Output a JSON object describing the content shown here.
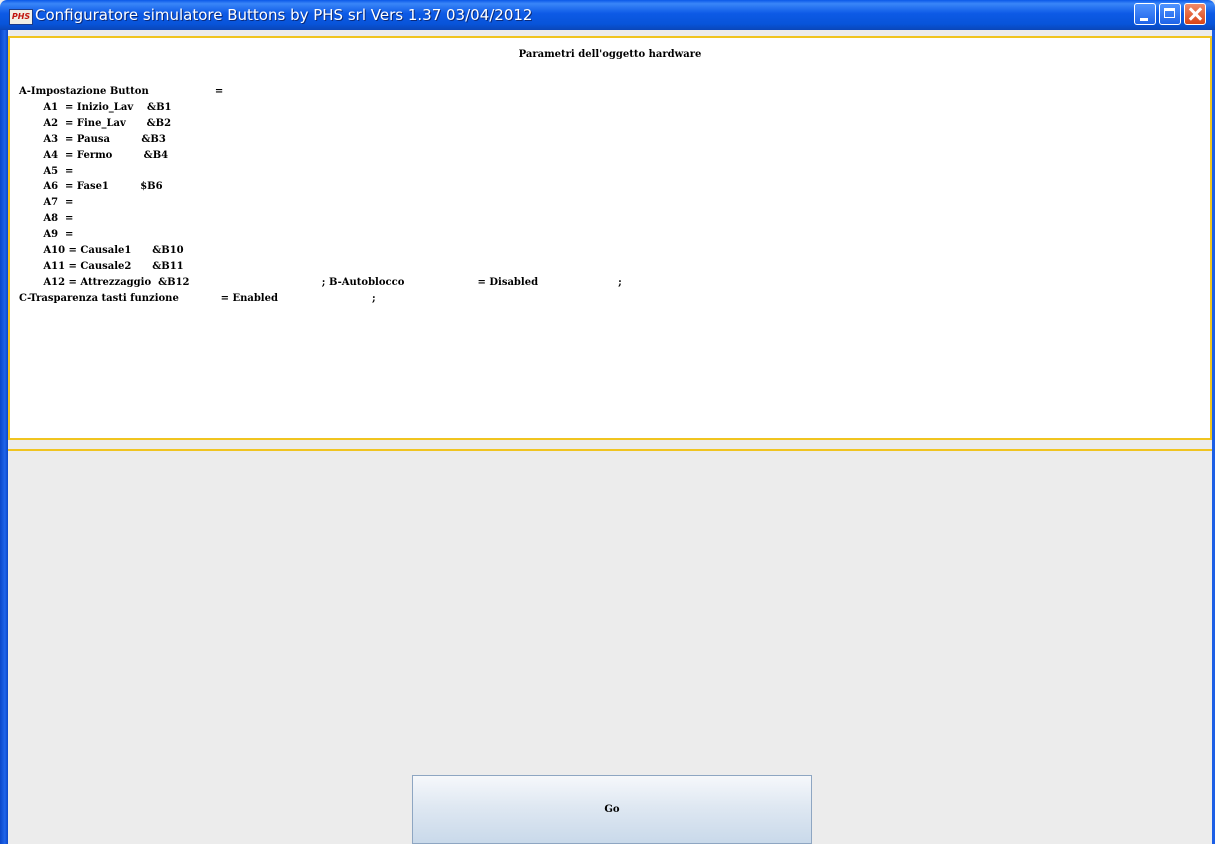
{
  "window": {
    "icon_label": "PHS",
    "title": "Configuratore simulatore Buttons by PHS srl  Vers 1.37  03/04/2012"
  },
  "parameters": {
    "heading": "Parametri dell'oggetto hardware",
    "content": "A-Impostazione Button                   =\n       A1  = Inizio_Lav    &B1\n       A2  = Fine_Lav      &B2\n       A3  = Pausa         &B3\n       A4  = Fermo         &B4\n       A5  =\n       A6  = Fase1         $B6\n       A7  =\n       A8  =\n       A9  =\n       A10 = Causale1      &B10\n       A11 = Causale2      &B11\n       A12 = Attrezzaggio  &B12                                      ; B-Autoblocco                     = Disabled                       ;\nC-Trasparenza tasti funzione            = Enabled                           ;"
  },
  "actions": {
    "go_label": "Go"
  },
  "colors": {
    "titlebar": "#0a58e8",
    "panel_border": "#f0c420",
    "background": "#ececec"
  }
}
